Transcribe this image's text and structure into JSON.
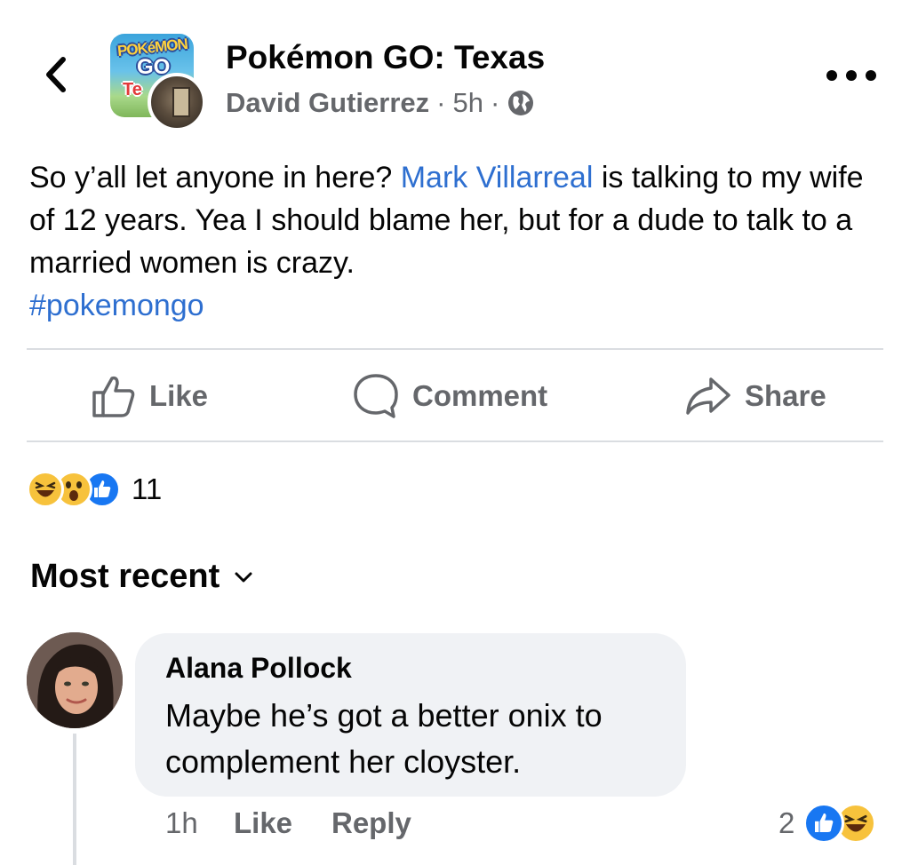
{
  "header": {
    "group_name": "Pokémon GO: Texas",
    "author": "David Gutierrez",
    "time": "5h",
    "separator": "·",
    "privacy_icon": "globe-icon",
    "back_icon": "chevron-left-icon",
    "more_icon": "more-horizontal-icon",
    "group_logo_top": "POKéMON",
    "group_logo_mid": "GO",
    "group_logo_bottom": "Te"
  },
  "post": {
    "text_before": "So y’all let anyone in here? ",
    "mention": "Mark Villarreal",
    "text_after": " is talking to my wife of 12 years. Yea I should blame her, but for a dude to talk to a married women is crazy.",
    "hashtag": "#pokemongo"
  },
  "actions": {
    "like": "Like",
    "comment": "Comment",
    "share": "Share"
  },
  "reactions": {
    "icons": [
      "haha-emoji-icon",
      "wow-emoji-icon",
      "like-reaction-icon"
    ],
    "count": "11"
  },
  "sort": {
    "label": "Most recent"
  },
  "comments": [
    {
      "name": "Alana Pollock",
      "text": "Maybe he’s got a better onix to complement her cloyster.",
      "time": "1h",
      "like_label": "Like",
      "reply_label": "Reply",
      "reaction_count": "2",
      "reaction_icons": [
        "like-reaction-icon",
        "haha-emoji-icon"
      ]
    }
  ],
  "colors": {
    "link": "#2e6fd0",
    "secondary_text": "#65676b",
    "bubble": "#f0f2f5",
    "like_blue": "#1877f2",
    "emoji_yellow": "#f7c23c"
  }
}
